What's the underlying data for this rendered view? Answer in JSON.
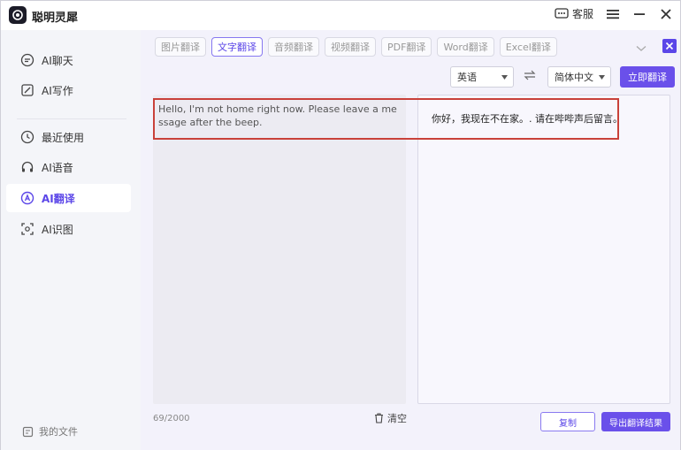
{
  "app": {
    "title": "聪明灵犀",
    "service_label": "客服"
  },
  "sidebar": {
    "items": [
      {
        "label": "AI聊天",
        "icon": "chat-icon"
      },
      {
        "label": "AI写作",
        "icon": "pen-icon"
      },
      {
        "label": "最近使用",
        "icon": "history-icon"
      },
      {
        "label": "AI语音",
        "icon": "headphone-icon"
      },
      {
        "label": "AI翻译",
        "icon": "translate-icon",
        "active": true
      },
      {
        "label": "AI识图",
        "icon": "scan-icon"
      }
    ],
    "footer_label": "我的文件"
  },
  "tabs": [
    "图片翻译",
    "文字翻译",
    "音频翻译",
    "视频翻译",
    "PDF翻译",
    "Word翻译",
    "Excel翻译"
  ],
  "active_tab": "文字翻译",
  "languages": {
    "source": "英语",
    "target": "简体中文"
  },
  "translate_button": "立即翻译",
  "source_text": "Hello, I'm not home right now. Please leave a message after the beep.",
  "target_text": "你好，我现在不在家。. 请在哔哔声后留言。",
  "char_count": "69/2000",
  "clear_label": "清空",
  "copy_label": "复制",
  "export_label": "导出翻译结果",
  "colors": {
    "accent": "#6a50ea",
    "highlight": "#c9413a"
  }
}
